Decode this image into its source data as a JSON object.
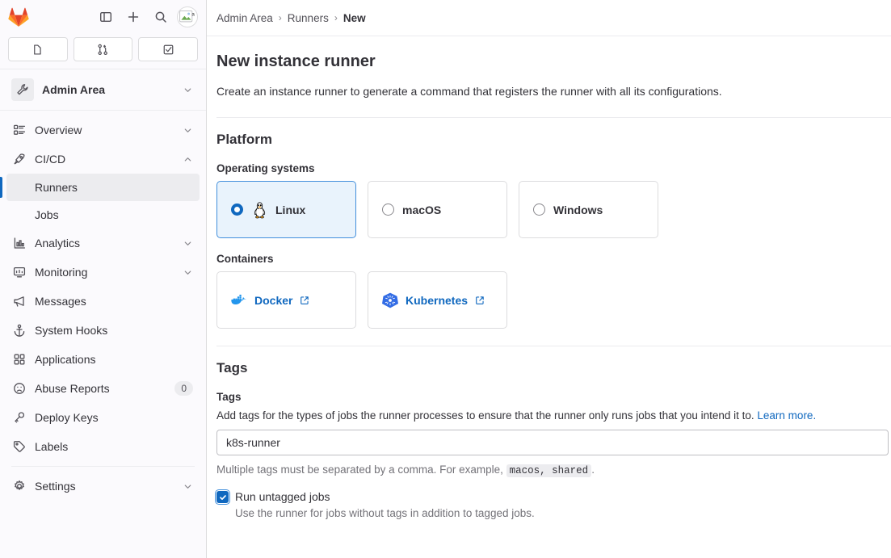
{
  "sidebar": {
    "logo": "gitlab-tanuki-logo",
    "top_actions": [
      {
        "name": "toggle-sidebar-icon",
        "label": "Toggle sidebar"
      },
      {
        "name": "create-new-icon",
        "label": "Create new"
      },
      {
        "name": "search-icon",
        "label": "Search"
      },
      {
        "name": "user-avatar",
        "label": "User avatar"
      }
    ],
    "count_buttons": [
      {
        "name": "issues-icon",
        "label": "Issues"
      },
      {
        "name": "merge-requests-icon",
        "label": "Merge requests"
      },
      {
        "name": "todos-icon",
        "label": "To-Do List"
      }
    ],
    "context": {
      "icon": "wrench-icon",
      "name": "Admin Area",
      "chevron": "chevron-down-icon"
    },
    "items": [
      {
        "label": "Overview",
        "icon": "overview-icon",
        "chevron": "chevron-down-icon",
        "type": "parent"
      },
      {
        "label": "CI/CD",
        "icon": "rocket-icon",
        "chevron": "chevron-up-icon",
        "type": "parent",
        "expanded": true
      },
      {
        "label": "Runners",
        "type": "child",
        "active": true
      },
      {
        "label": "Jobs",
        "type": "child",
        "active": false
      },
      {
        "label": "Analytics",
        "icon": "chart-icon",
        "chevron": "chevron-down-icon",
        "type": "parent"
      },
      {
        "label": "Monitoring",
        "icon": "monitor-icon",
        "chevron": "chevron-down-icon",
        "type": "parent"
      },
      {
        "label": "Messages",
        "icon": "megaphone-icon",
        "type": "leaf"
      },
      {
        "label": "System Hooks",
        "icon": "anchor-icon",
        "type": "leaf"
      },
      {
        "label": "Applications",
        "icon": "applications-icon",
        "type": "leaf"
      },
      {
        "label": "Abuse Reports",
        "icon": "abuse-icon",
        "type": "leaf",
        "badge": "0"
      },
      {
        "label": "Deploy Keys",
        "icon": "key-icon",
        "type": "leaf"
      },
      {
        "label": "Labels",
        "icon": "label-icon",
        "type": "leaf"
      },
      {
        "label": "Settings",
        "icon": "gear-icon",
        "chevron": "chevron-down-icon",
        "type": "parent",
        "divider_before": true
      }
    ]
  },
  "breadcrumb": {
    "items": [
      "Admin Area",
      "Runners",
      "New"
    ],
    "separator": "›"
  },
  "page": {
    "title": "New instance runner",
    "description": "Create an instance runner to generate a command that registers the runner with all its configurations."
  },
  "platform": {
    "heading": "Platform",
    "os_label": "Operating systems",
    "os_options": [
      {
        "label": "Linux",
        "icon": "tux-icon",
        "selected": true
      },
      {
        "label": "macOS",
        "icon": "",
        "selected": false
      },
      {
        "label": "Windows",
        "icon": "",
        "selected": false
      }
    ],
    "containers_label": "Containers",
    "containers": [
      {
        "label": "Docker",
        "icon": "docker-icon",
        "external": "external-link-icon"
      },
      {
        "label": "Kubernetes",
        "icon": "kubernetes-icon",
        "external": "external-link-icon"
      }
    ]
  },
  "tags": {
    "heading": "Tags",
    "field_label": "Tags",
    "help_text": "Add tags for the types of jobs the runner processes to ensure that the runner only runs jobs that you intend it to. ",
    "help_link": "Learn more.",
    "input_value": "k8s-runner",
    "input_placeholder": "",
    "sub_help_prefix": "Multiple tags must be separated by a comma. For example, ",
    "sub_help_code": "macos, shared",
    "sub_help_suffix": ".",
    "untagged_label": "Run untagged jobs",
    "untagged_desc": "Use the runner for jobs without tags in addition to tagged jobs.",
    "untagged_checked": true
  },
  "colors": {
    "accent_blue": "#1068bf",
    "selected_bg": "#e9f3fc",
    "selected_border": "#428fdc",
    "sidebar_bg": "#fbfafd",
    "border": "#dcdcde",
    "text": "#333238",
    "muted": "#737278"
  }
}
